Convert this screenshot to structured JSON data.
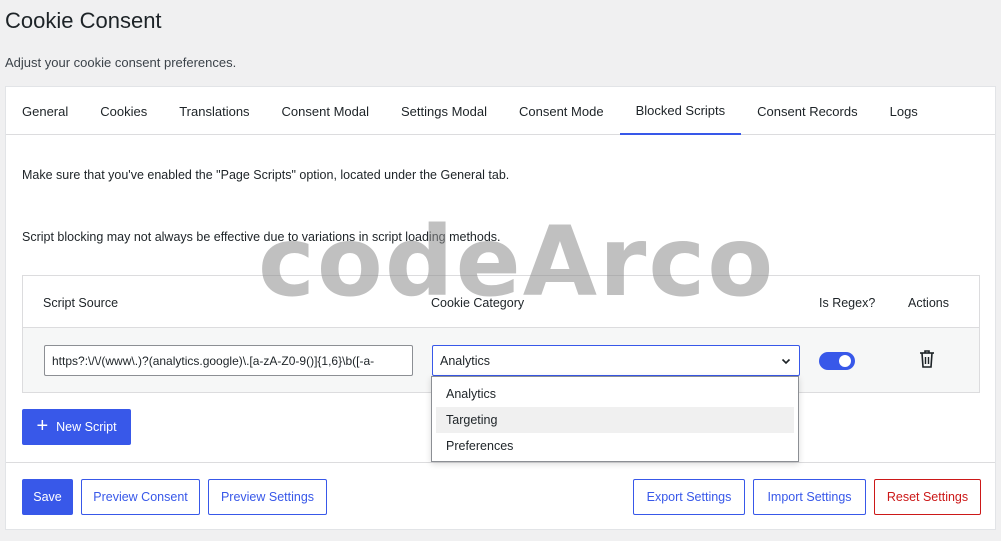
{
  "header": {
    "title": "Cookie Consent",
    "subtitle": "Adjust your cookie consent preferences."
  },
  "tabs": [
    {
      "label": "General"
    },
    {
      "label": "Cookies"
    },
    {
      "label": "Translations"
    },
    {
      "label": "Consent Modal"
    },
    {
      "label": "Settings Modal"
    },
    {
      "label": "Consent Mode"
    },
    {
      "label": "Blocked Scripts",
      "active": true
    },
    {
      "label": "Consent Records"
    },
    {
      "label": "Logs"
    }
  ],
  "notices": {
    "page_scripts": "Make sure that you've enabled the \"Page Scripts\" option, located under the General tab.",
    "loading_methods": "Script blocking may not always be effective due to variations in script loading methods."
  },
  "table": {
    "columns": {
      "source": "Script Source",
      "category": "Cookie Category",
      "regex": "Is Regex?",
      "actions": "Actions"
    },
    "rows": [
      {
        "source": "https?:\\/\\/(www\\.)?(analytics.google)\\.[a-zA-Z0-9()]{1,6}\\b([-a-",
        "category": "Analytics",
        "is_regex": true
      }
    ]
  },
  "category_dropdown": {
    "options": [
      "Analytics",
      "Targeting",
      "Preferences"
    ],
    "hovered": "Targeting"
  },
  "buttons": {
    "new_script": "New Script",
    "save": "Save",
    "preview_consent": "Preview Consent",
    "preview_settings": "Preview Settings",
    "export_settings": "Export Settings",
    "import_settings": "Import Settings",
    "reset_settings": "Reset Settings"
  },
  "watermark": "codeArco",
  "colors": {
    "accent": "#3858e9",
    "danger": "#cc1818",
    "background": "#f0f0f1"
  }
}
